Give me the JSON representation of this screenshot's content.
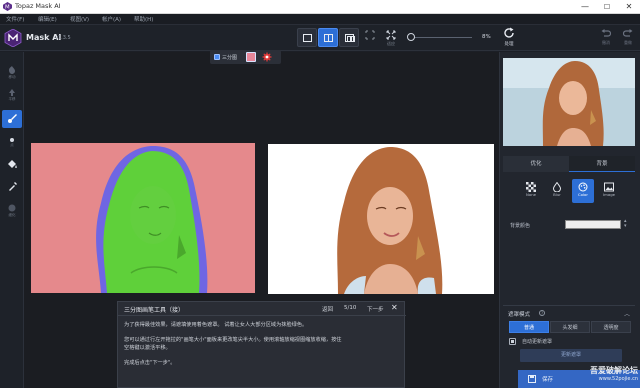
{
  "window": {
    "title": "Topaz Mask AI",
    "minimize": "—",
    "maximize": "☐",
    "close": "✕"
  },
  "menu": [
    "文件(F)",
    "编辑(E)",
    "视图(V)",
    "帐户(A)",
    "帮助(H)"
  ],
  "brand": {
    "name": "Mask AI",
    "version": "v1.3.5"
  },
  "toolbar": {
    "fit_label": "适应",
    "zoom_value": "8%",
    "process_label": "处理",
    "undo_label": "撤消",
    "redo_label": "重做"
  },
  "left_tools": [
    {
      "name": "move-tool",
      "label": "移动"
    },
    {
      "name": "hand-tool",
      "label": "平移"
    },
    {
      "name": "brush-tool",
      "label": "画笔",
      "active": true
    },
    {
      "name": "dot-tool",
      "label": "点"
    },
    {
      "name": "fill-tool",
      "label": "填充"
    },
    {
      "name": "eyedropper-tool",
      "label": "吸管"
    },
    {
      "name": "refine-tool",
      "label": "细化"
    }
  ],
  "canvas": {
    "overlay_label": "三分图",
    "colors": {
      "background_red": "#e7879a",
      "foreground_green": "#5fd03a",
      "computed_blue": "#6f66e3"
    }
  },
  "tutorial": {
    "title": "三分图画笔工具（接）",
    "back": "返回",
    "page": "5/10",
    "next": "下一步",
    "close": "✕",
    "p1": "为了获得最佳效果，请遮填使用着色遮罩。 试着让女人大部分区域为抹脸绿色。",
    "p2a": "您可以通过行左开拖拉的\"画笔大小\"面板来更改笔尖半大小。使用滚轴放缩视图缩放收缩，按住",
    "p2b": "空格键以激活平移。",
    "p3": "完成后点击\"下一步\"。"
  },
  "right_panel": {
    "tabs": [
      "优化",
      "背景"
    ],
    "bg_options": [
      {
        "name": "bg-option-none",
        "label": "None"
      },
      {
        "name": "bg-option-blur",
        "label": "Blur"
      },
      {
        "name": "bg-option-color",
        "label": "Color",
        "active": true
      },
      {
        "name": "bg-option-image",
        "label": "Image"
      }
    ],
    "bg_color_label": "背景颜色",
    "bg_color_value": "#eeeeee",
    "mode_label": "遮罩模式",
    "mode_help": "?",
    "mode_collapse": "︿",
    "modes": [
      "普通",
      "头发细",
      "透明度"
    ],
    "auto_update_label": "自动更新遮罩",
    "update_button": "更新遮罩",
    "save_button": "保存"
  },
  "watermark": {
    "line1": "吾爱破解论坛",
    "line2": "www.52pojie.cn"
  }
}
